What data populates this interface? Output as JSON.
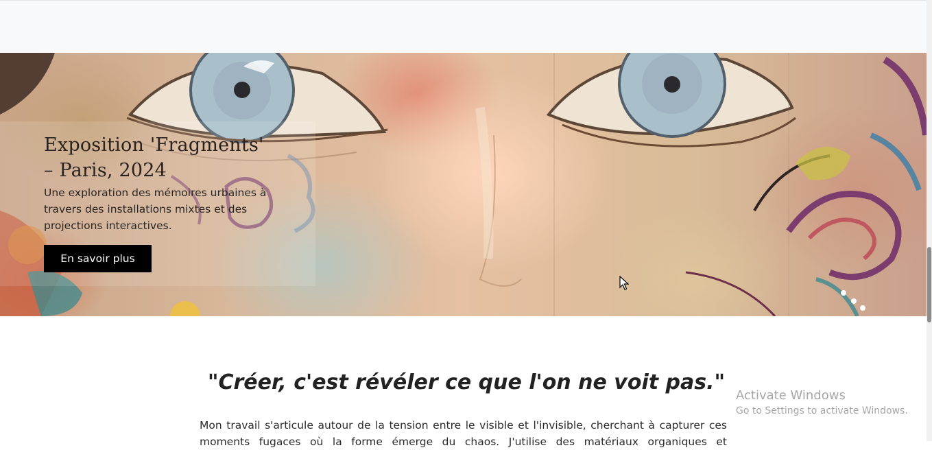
{
  "exhibition": {
    "title": "Exposition 'Fragments' – Paris, 2024",
    "description": "Une exploration des mémoires urbaines à travers des installations mixtes et des projections interactives.",
    "button_label": "En savoir plus"
  },
  "statement": {
    "quote": "\"Créer, c'est révéler ce que l'on ne voit pas.\"",
    "paragraph": "Mon travail s'articule autour de la tension entre le visible et l'invisible, cherchant à capturer ces moments fugaces où la forme émerge du chaos. J'utilise des matériaux organiques et"
  },
  "os_watermark": {
    "title": "Activate Windows",
    "subtitle": "Go to Settings to activate Windows."
  },
  "colors": {
    "button_bg": "#000000",
    "button_text": "#ffffff",
    "top_band": "#f8f9fb"
  },
  "icons": {
    "cursor": "mouse-pointer-icon"
  }
}
